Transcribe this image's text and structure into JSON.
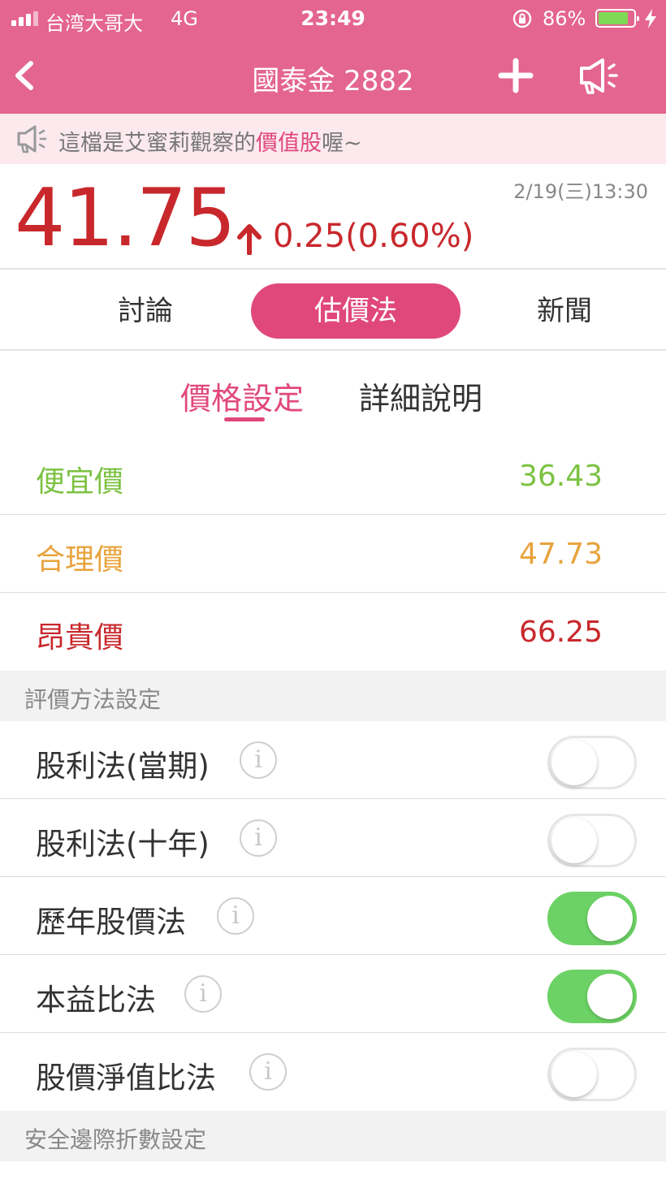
{
  "status_bar": {
    "carrier": "台湾大哥大",
    "network": "4G",
    "time": "23:49",
    "battery_percent": "86%",
    "battery_level": 0.86
  },
  "nav": {
    "title": "國泰金 2882",
    "back_icon": "chevron-left-icon",
    "add_icon": "plus-icon",
    "speaker_icon": "megaphone-icon"
  },
  "notice": {
    "prefix": "這檔是艾蜜莉觀察的",
    "highlight": "價值股",
    "suffix": "喔~"
  },
  "quote": {
    "price": "41.75",
    "change": "0.25(0.60%)",
    "direction": "up",
    "datetime": "2/19(三)13:30"
  },
  "tabs": [
    {
      "label": "討論",
      "active": false
    },
    {
      "label": "估價法",
      "active": true
    },
    {
      "label": "新聞",
      "active": false
    }
  ],
  "subtabs": [
    {
      "label": "價格設定",
      "active": true
    },
    {
      "label": "詳細說明",
      "active": false
    }
  ],
  "levels": [
    {
      "label": "便宜價",
      "value": "36.43",
      "color": "#7cc242"
    },
    {
      "label": "合理價",
      "value": "47.73",
      "color": "#e8a33c"
    },
    {
      "label": "昂貴價",
      "value": "66.25",
      "color": "#c8282c"
    }
  ],
  "methods_section": {
    "title": "評價方法設定"
  },
  "methods": [
    {
      "label": "股利法(當期)",
      "enabled": false
    },
    {
      "label": "股利法(十年)",
      "enabled": false
    },
    {
      "label": "歷年股價法",
      "enabled": true
    },
    {
      "label": "本益比法",
      "enabled": true
    },
    {
      "label": "股價淨值比法",
      "enabled": false
    }
  ],
  "info_glyph": "i",
  "safety_section": {
    "title": "安全邊際折數設定"
  },
  "colors": {
    "brand": "#e4658f",
    "accent": "#e0487b",
    "up": "#c8282c",
    "toggle_on": "#6cd265"
  }
}
